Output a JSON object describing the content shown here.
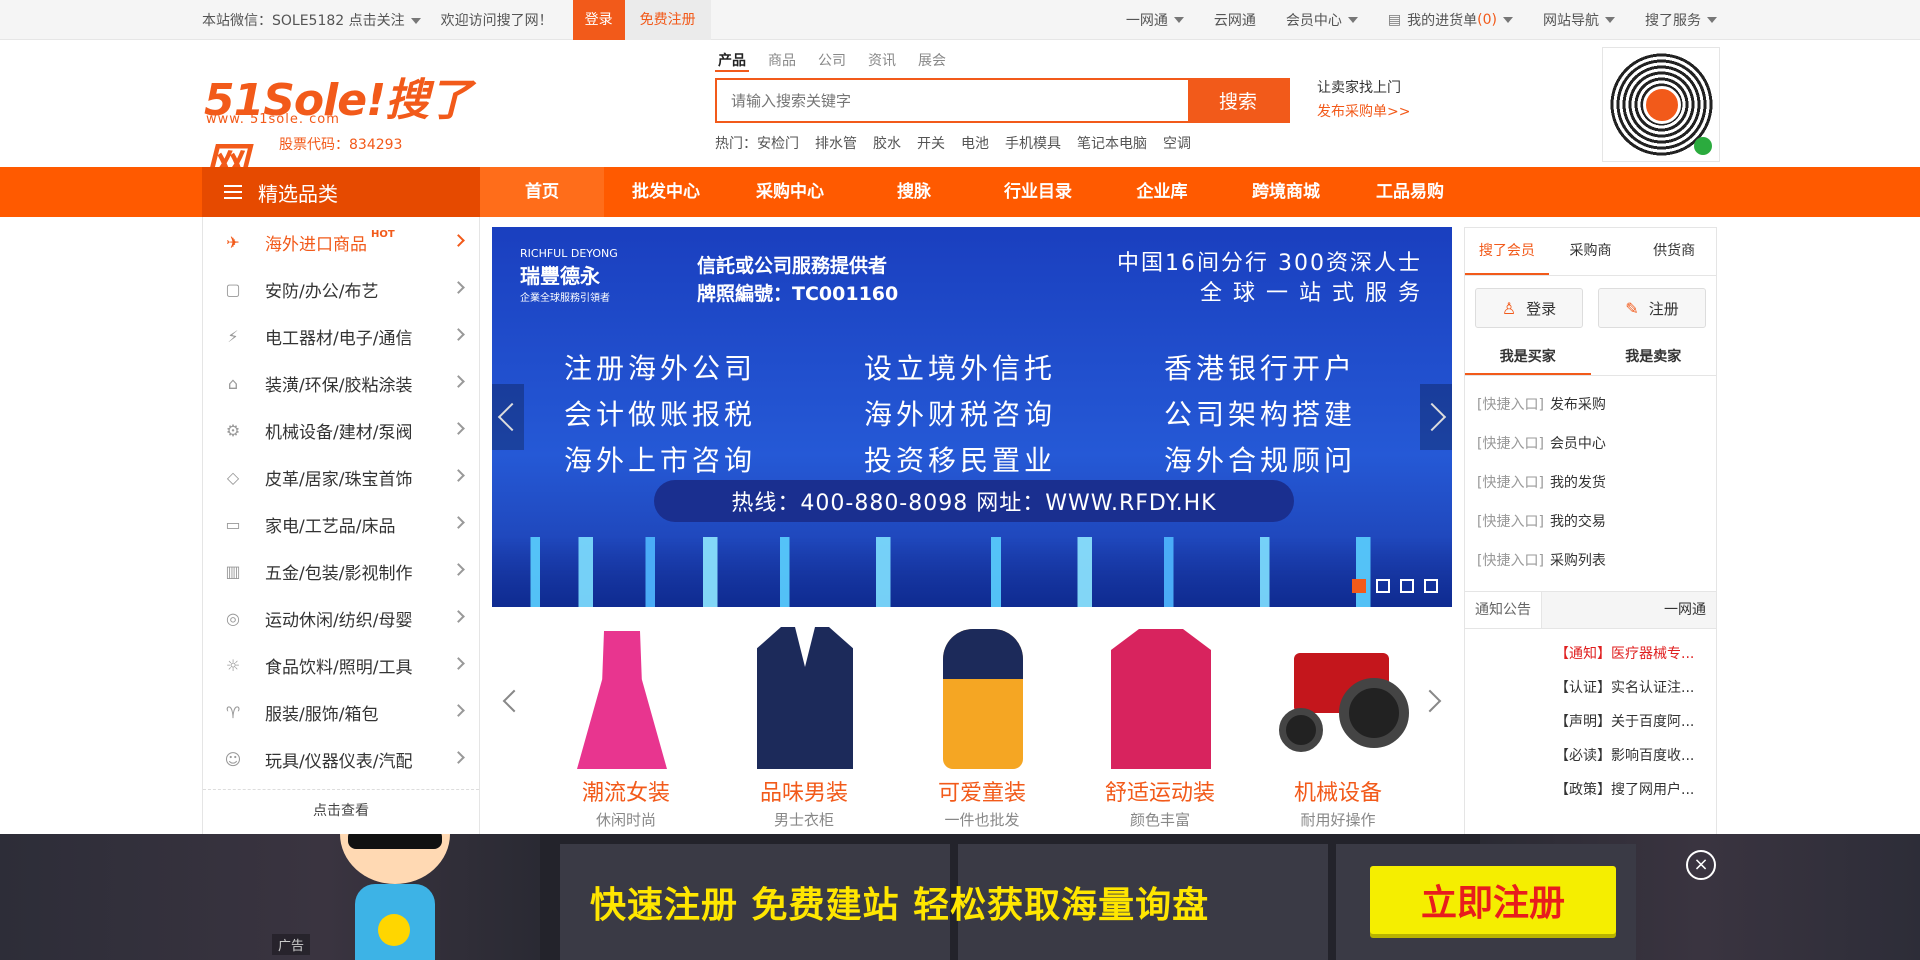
{
  "topbar": {
    "wechat": "本站微信：SOLE5182 点击关注",
    "welcome": "欢迎访问搜了网！",
    "login": "登录",
    "register": "免费注册",
    "right": {
      "yiwangtong": "一网通",
      "yunwangtong": "云网通",
      "member_center": "会员中心",
      "order_list": "我的进货单",
      "order_count": "(0)",
      "site_nav": "网站导航",
      "service": "搜了服务"
    }
  },
  "logo": {
    "main": "51Sole!搜了网",
    "url": "www. 51sole. com",
    "stock": "股票代码：834293"
  },
  "search": {
    "tabs": [
      "产品",
      "商品",
      "公司",
      "资讯",
      "展会"
    ],
    "placeholder": "请输入搜索关键字",
    "button": "搜索",
    "hot_label": "热门：",
    "hot": [
      "安检门",
      "排水管",
      "胶水",
      "开关",
      "电池",
      "手机模具",
      "笔记本电脑",
      "空调"
    ]
  },
  "seller": {
    "line1": "让卖家找上门",
    "line2": "发布采购单>>"
  },
  "nav": {
    "category_title": "精选品类",
    "items": [
      "首页",
      "批发中心",
      "采购中心",
      "搜脉",
      "行业目录",
      "企业库",
      "跨境商城",
      "工品易购"
    ]
  },
  "categories": {
    "items": [
      {
        "label": "海外进口商品",
        "tag": "HOT",
        "icon": "plane-icon"
      },
      {
        "label": "安防/办公/布艺",
        "icon": "security-icon"
      },
      {
        "label": "电工器材/电子/通信",
        "icon": "electric-icon"
      },
      {
        "label": "装潢/环保/胶粘涂装",
        "icon": "decor-icon"
      },
      {
        "label": "机械设备/建材/泵阀",
        "icon": "gear-icon"
      },
      {
        "label": "皮革/居家/珠宝首饰",
        "icon": "box-icon"
      },
      {
        "label": "家电/工艺品/床品",
        "icon": "monitor-icon"
      },
      {
        "label": "五金/包装/影视制作",
        "icon": "hardware-icon"
      },
      {
        "label": "运动休闲/纺织/母婴",
        "icon": "ball-icon"
      },
      {
        "label": "食品饮料/照明/工具",
        "icon": "bulb-icon"
      },
      {
        "label": "服装/服饰/箱包",
        "icon": "shirt-icon"
      },
      {
        "label": "玩具/仪器仪表/汽配",
        "icon": "toy-icon"
      }
    ],
    "more": "点击查看"
  },
  "banner": {
    "brand_en": "RICHFUL DEYONG",
    "brand_cn": "瑞豐德永",
    "brand_sub": "企業全球服務引領者",
    "license1": "信託或公司服務提供者",
    "license2": "牌照編號：TC001160",
    "branch1": "中国16间分行  300资深人士",
    "branch2": "全 球 一 站 式 服 务",
    "services": [
      "注册海外公司",
      "设立境外信托",
      "香港银行开户",
      "会计做账报税",
      "海外财税咨询",
      "公司架构搭建",
      "海外上市咨询",
      "投资移民置业",
      "海外合规顾问"
    ],
    "hotline": "热线：400-880-8098    网址：WWW.RFDY.HK"
  },
  "products": [
    {
      "name": "潮流女装",
      "sub": "休闲时尚"
    },
    {
      "name": "品味男装",
      "sub": "男士衣柜"
    },
    {
      "name": "可爱童装",
      "sub": "一件也批发"
    },
    {
      "name": "舒适运动装",
      "sub": "颜色丰富"
    },
    {
      "name": "机械设备",
      "sub": "耐用好操作"
    }
  ],
  "side": {
    "tabs": [
      "搜了会员",
      "采购商",
      "供货商"
    ],
    "login": "登录",
    "register": "注册",
    "roles": [
      "我是买家",
      "我是卖家"
    ],
    "quick_tag": "[快捷入口]",
    "quick": [
      "发布采购",
      "会员中心",
      "我的发货",
      "我的交易",
      "采购列表"
    ],
    "notice_tabs": [
      "通知公告",
      "一网通"
    ],
    "notices": [
      "【通知】医疗器械专...",
      "【认证】实名认证注...",
      "【声明】关于百度阿...",
      "【必读】影响百度收...",
      "【政策】搜了网用户..."
    ]
  },
  "ad": {
    "text": "快速注册  免费建站  轻松获取海量询盘",
    "button": "立即注册",
    "tag": "广告",
    "close": "×"
  },
  "colors": {
    "brand": "#f25a1a",
    "nav": "#ff5a00",
    "ad_yellow": "#f5ee00"
  }
}
